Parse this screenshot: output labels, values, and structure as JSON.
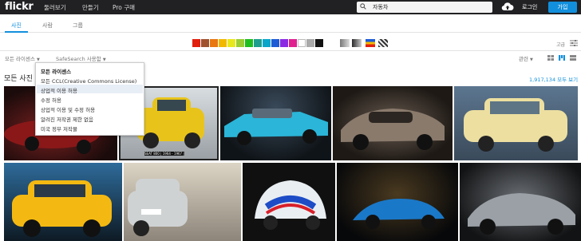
{
  "topbar": {
    "logo": "flickr",
    "nav": [
      "둘러보기",
      "만들기",
      "Pro 구매"
    ],
    "search_value": "자동차",
    "login": "로그인",
    "signup": "가입"
  },
  "tabs": [
    "사진",
    "사람",
    "그룹"
  ],
  "colors": [
    "#e11f0d",
    "#a0522d",
    "#e8780f",
    "#f2b800",
    "#e8e81e",
    "#9acd32",
    "#1fbe1f",
    "#1f9e8e",
    "#0aa5c8",
    "#1d5bd6",
    "#8a2be2",
    "#e0208f",
    "#ffffff",
    "#a9a9a9",
    "#111111"
  ],
  "advanced": "고급",
  "filters": {
    "license": "모든 라이센스",
    "safesearch": "SafeSearch 사용함",
    "relevance": "관련"
  },
  "results": {
    "title": "모든 사진",
    "count": "1,917,134 모두 보기"
  },
  "license_menu": [
    "모든 라이센스",
    "모든 CCL(Creative Commons License)",
    "상업적 이용 허용",
    "수정 허용",
    "상업적 이용 및 수정 허용",
    "알려진 저작권 제한 없음",
    "미국 정부 저작물"
  ],
  "photos": {
    "caption": "SEAT 800 | 1964 - 1967 |"
  }
}
